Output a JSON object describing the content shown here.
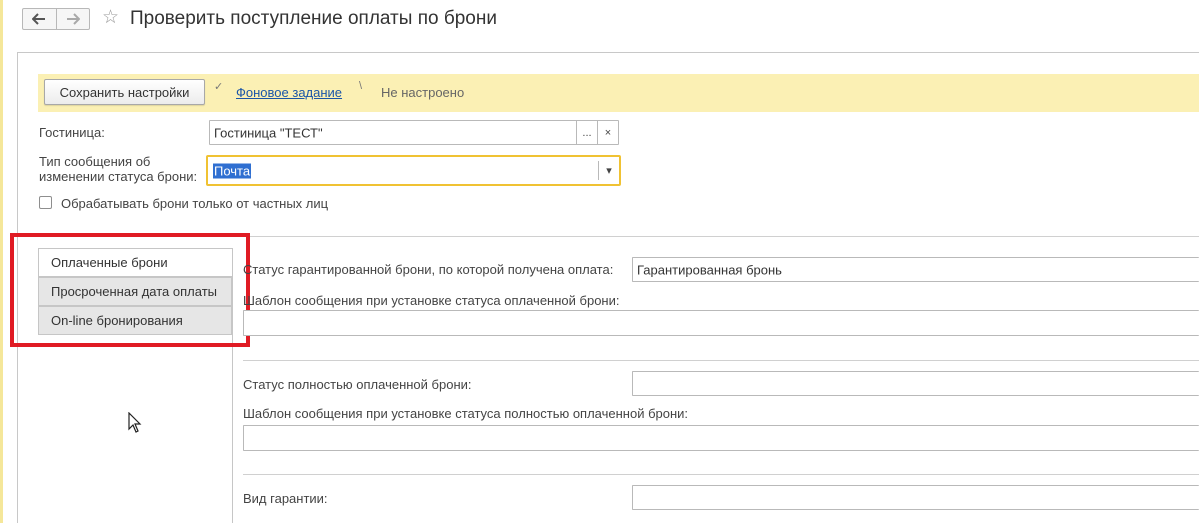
{
  "window": {
    "title": "Проверить поступление оплаты по брони"
  },
  "nav": {
    "back_icon": "arrow-left-icon",
    "forward_icon": "arrow-right-icon",
    "favorite_icon": "star-icon"
  },
  "toolbar": {
    "save_settings_label": "Сохранить настройки",
    "background_task_link": "Фоновое задание",
    "background_task_status": "Не настроено"
  },
  "form": {
    "hotel": {
      "label": "Гостиница:",
      "value": "Гостиница \"ТЕСТ\"",
      "choose_button": "...",
      "clear_button": "×"
    },
    "message_type": {
      "label_line1": "Тип сообщения об",
      "label_line2": "изменении статуса брони:",
      "value": "Почта",
      "dropdown_icon": "▾"
    },
    "private_only": {
      "label": "Обрабатывать брони только от частных лиц",
      "checked": false
    }
  },
  "tabs": [
    {
      "label": "Оплаченные брони",
      "active": true
    },
    {
      "label": "Просроченная дата оплаты",
      "active": false
    },
    {
      "label": "On-line бронирования",
      "active": false
    }
  ],
  "paid_tab": {
    "guaranteed_status": {
      "label": "Статус гарантированной брони, по которой получена оплата:",
      "value": "Гарантированная бронь"
    },
    "paid_template": {
      "label": "Шаблон сообщения при установке статуса оплаченной брони:",
      "value": ""
    },
    "fully_paid_status": {
      "label": "Статус полностью оплаченной брони:",
      "value": ""
    },
    "fully_paid_template": {
      "label": "Шаблон сообщения при установке статуса полностью оплаченной брони:",
      "value": ""
    },
    "guarantee_type": {
      "label": "Вид гарантии:",
      "value": ""
    }
  },
  "colors": {
    "command_bar": "#fbf0b4",
    "focus_border": "#f0c233",
    "highlight_box": "#e01b24",
    "link": "#1a55a8"
  }
}
